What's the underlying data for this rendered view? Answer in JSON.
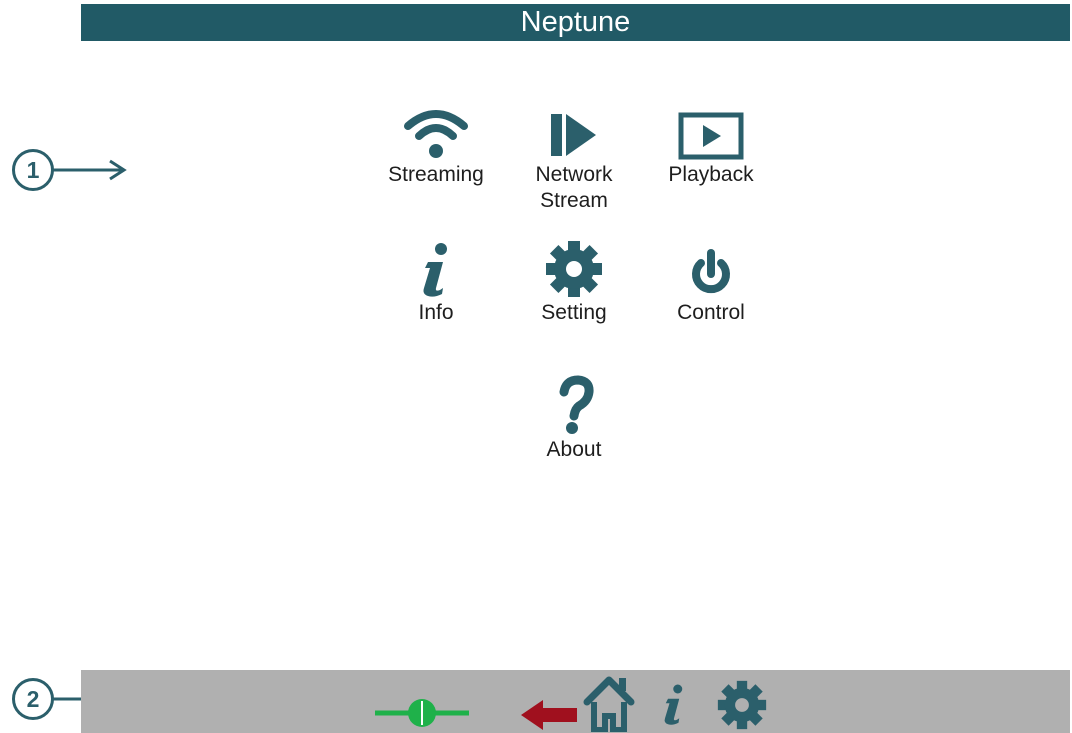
{
  "header": {
    "title": "Neptune"
  },
  "callouts": [
    "1",
    "2"
  ],
  "menu": {
    "items": [
      {
        "label": "Streaming",
        "icon": "wifi-icon"
      },
      {
        "label": "Network\nStream",
        "icon": "network-stream-icon"
      },
      {
        "label": "Playback",
        "icon": "playback-icon"
      },
      {
        "label": "Info",
        "icon": "info-icon"
      },
      {
        "label": "Setting",
        "icon": "gear-icon"
      },
      {
        "label": "Control",
        "icon": "power-icon"
      },
      {
        "label": "About",
        "icon": "question-icon"
      }
    ]
  },
  "bottombar": {
    "icons": [
      "connection-status-icon",
      "back-arrow-icon",
      "home-icon",
      "info-icon",
      "gear-icon"
    ]
  },
  "colors": {
    "brand": "#215a66",
    "icon": "#2b5f6b",
    "connected": "#1fb14a",
    "back": "#a0101e",
    "bar": "#b0b0b0"
  }
}
